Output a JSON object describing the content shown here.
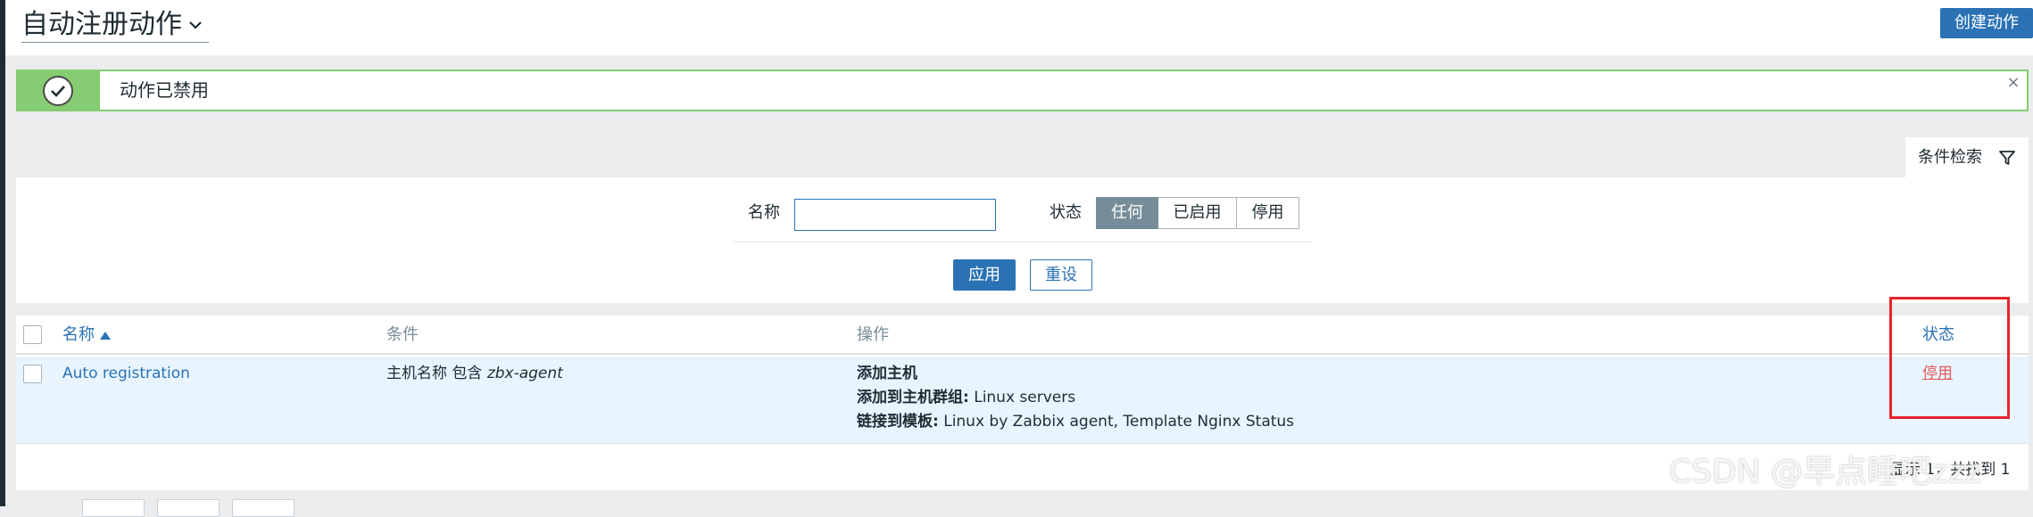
{
  "header": {
    "title": "自动注册动作",
    "create_button": "创建动作"
  },
  "message": {
    "text": "动作已禁用",
    "close_glyph": "×"
  },
  "filter": {
    "tab_label": "条件检索",
    "name_label": "名称",
    "name_value": "",
    "status_label": "状态",
    "status_options": [
      "任何",
      "已启用",
      "停用"
    ],
    "status_selected": "任何",
    "apply_label": "应用",
    "reset_label": "重设"
  },
  "table": {
    "columns": {
      "name": "名称",
      "conditions": "条件",
      "operations": "操作",
      "status": "状态"
    },
    "rows": [
      {
        "name": "Auto registration",
        "condition_prefix": "主机名称 包含 ",
        "condition_value": "zbx-agent",
        "operations": [
          {
            "label": "添加主机",
            "value": ""
          },
          {
            "label": "添加到主机群组:",
            "value": " Linux servers"
          },
          {
            "label": "链接到模板:",
            "value": " Linux by Zabbix agent, Template Nginx Status"
          }
        ],
        "status": "停用"
      }
    ],
    "footer": "显示 1，共找到 1"
  },
  "watermark": "CSDN @早点睡吧zzz",
  "colors": {
    "accent": "#2b72b5",
    "success": "#86cc72",
    "disabled_status": "#e45959",
    "highlight": "#e8232a"
  }
}
